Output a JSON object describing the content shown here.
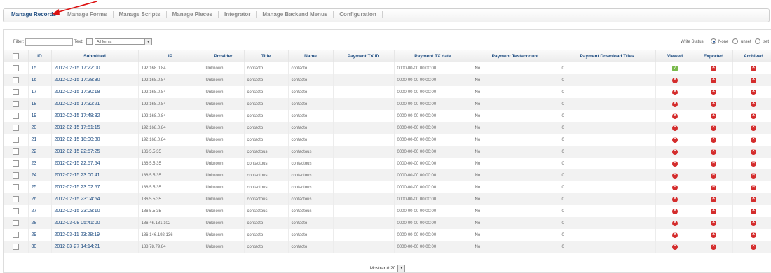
{
  "tabs": [
    "Manage Records",
    "Manage Forms",
    "Manage Scripts",
    "Manage Pieces",
    "Integrator",
    "Manage Backend Menus",
    "Configuration"
  ],
  "filter": {
    "filter_label": "Filter:",
    "text_label": "Text:",
    "form_select": "All forms",
    "write_status_label": "Write Status:",
    "options": [
      "None",
      "unset",
      "set"
    ]
  },
  "columns": [
    "ID",
    "Submitted",
    "IP",
    "Provider",
    "Title",
    "Name",
    "Payment TX ID",
    "Payment TX date",
    "Payment Testaccount",
    "Payment Download Tries",
    "Viewed",
    "Exported",
    "Archived"
  ],
  "rows": [
    {
      "id": "15",
      "submitted": "2012-02-15 17:22:00",
      "ip": "192.168.0.84",
      "provider": "Unknown",
      "title": "contacto",
      "name": "contacto",
      "txid": "",
      "txdate": "0000-00-00 00:00:00",
      "test": "No",
      "tries": "0",
      "viewed": true
    },
    {
      "id": "16",
      "submitted": "2012-02-15 17:28:30",
      "ip": "192.168.0.84",
      "provider": "Unknown",
      "title": "contacto",
      "name": "contacto",
      "txid": "",
      "txdate": "0000-00-00 00:00:00",
      "test": "No",
      "tries": "0",
      "viewed": false
    },
    {
      "id": "17",
      "submitted": "2012-02-15 17:30:18",
      "ip": "192.168.0.84",
      "provider": "Unknown",
      "title": "contacto",
      "name": "contacto",
      "txid": "",
      "txdate": "0000-00-00 00:00:00",
      "test": "No",
      "tries": "0",
      "viewed": false
    },
    {
      "id": "18",
      "submitted": "2012-02-15 17:32:21",
      "ip": "192.168.0.84",
      "provider": "Unknown",
      "title": "contacto",
      "name": "contacto",
      "txid": "",
      "txdate": "0000-00-00 00:00:00",
      "test": "No",
      "tries": "0",
      "viewed": false
    },
    {
      "id": "19",
      "submitted": "2012-02-15 17:48:32",
      "ip": "192.168.0.84",
      "provider": "Unknown",
      "title": "contacto",
      "name": "contacto",
      "txid": "",
      "txdate": "0000-00-00 00:00:00",
      "test": "No",
      "tries": "0",
      "viewed": false
    },
    {
      "id": "20",
      "submitted": "2012-02-15 17:51:15",
      "ip": "192.168.0.84",
      "provider": "Unknown",
      "title": "contacto",
      "name": "contacto",
      "txid": "",
      "txdate": "0000-00-00 00:00:00",
      "test": "No",
      "tries": "0",
      "viewed": false
    },
    {
      "id": "21",
      "submitted": "2012-02-15 18:00:30",
      "ip": "192.168.0.84",
      "provider": "Unknown",
      "title": "contacto",
      "name": "contacto",
      "txid": "",
      "txdate": "0000-00-00 00:00:00",
      "test": "No",
      "tries": "0",
      "viewed": false
    },
    {
      "id": "22",
      "submitted": "2012-02-15 22:57:25",
      "ip": "186.5.5.35",
      "provider": "Unknown",
      "title": "contactous",
      "name": "contactous",
      "txid": "",
      "txdate": "0000-00-00 00:00:00",
      "test": "No",
      "tries": "0",
      "viewed": false
    },
    {
      "id": "23",
      "submitted": "2012-02-15 22:57:54",
      "ip": "186.5.5.35",
      "provider": "Unknown",
      "title": "contactous",
      "name": "contactous",
      "txid": "",
      "txdate": "0000-00-00 00:00:00",
      "test": "No",
      "tries": "0",
      "viewed": false
    },
    {
      "id": "24",
      "submitted": "2012-02-15 23:00:41",
      "ip": "186.5.5.35",
      "provider": "Unknown",
      "title": "contactous",
      "name": "contactous",
      "txid": "",
      "txdate": "0000-00-00 00:00:00",
      "test": "No",
      "tries": "0",
      "viewed": false
    },
    {
      "id": "25",
      "submitted": "2012-02-15 23:02:57",
      "ip": "186.5.5.35",
      "provider": "Unknown",
      "title": "contactous",
      "name": "contactous",
      "txid": "",
      "txdate": "0000-00-00 00:00:00",
      "test": "No",
      "tries": "0",
      "viewed": false
    },
    {
      "id": "26",
      "submitted": "2012-02-15 23:04:54",
      "ip": "186.5.5.35",
      "provider": "Unknown",
      "title": "contactous",
      "name": "contactous",
      "txid": "",
      "txdate": "0000-00-00 00:00:00",
      "test": "No",
      "tries": "0",
      "viewed": false
    },
    {
      "id": "27",
      "submitted": "2012-02-15 23:08:10",
      "ip": "186.5.5.35",
      "provider": "Unknown",
      "title": "contactous",
      "name": "contactous",
      "txid": "",
      "txdate": "0000-00-00 00:00:00",
      "test": "No",
      "tries": "0",
      "viewed": false
    },
    {
      "id": "28",
      "submitted": "2012-03-08 05:41:00",
      "ip": "186.46.181.102",
      "provider": "Unknown",
      "title": "contacto",
      "name": "contacto",
      "txid": "",
      "txdate": "0000-00-00 00:00:00",
      "test": "No",
      "tries": "0",
      "viewed": false
    },
    {
      "id": "29",
      "submitted": "2012-03-11 23:28:19",
      "ip": "186.146.192.136",
      "provider": "Unknown",
      "title": "contacto",
      "name": "contacto",
      "txid": "",
      "txdate": "0000-00-00 00:00:00",
      "test": "No",
      "tries": "0",
      "viewed": false
    },
    {
      "id": "30",
      "submitted": "2012-03-27 14:14:21",
      "ip": "188.78.79.84",
      "provider": "Unknown",
      "title": "contacto",
      "name": "contacto",
      "txid": "",
      "txdate": "0000-00-00 00:00:00",
      "test": "No",
      "tries": "0",
      "viewed": false
    }
  ],
  "footer": {
    "label": "Mostrar # 20"
  }
}
